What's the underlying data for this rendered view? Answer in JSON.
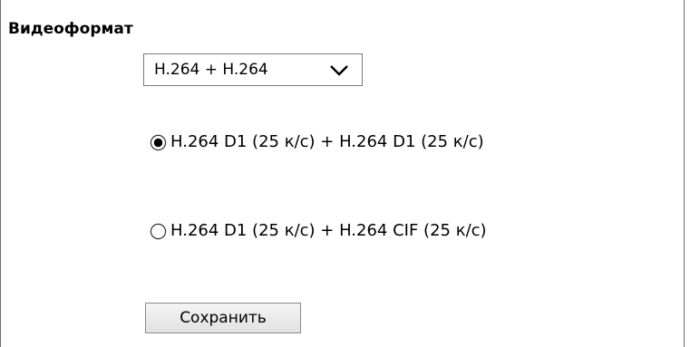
{
  "video_format": {
    "title": "Видеоформат",
    "select": {
      "value": "H.264 + H.264",
      "arrow_icon": "chevron-down-icon"
    },
    "options": [
      {
        "label": "H.264 D1 (25 к/с) + H.264 D1 (25 к/с)",
        "checked": true
      },
      {
        "label": "H.264 D1 (25 к/с) + H.264 CIF (25 к/с)",
        "checked": false
      }
    ],
    "save_label": "Сохранить"
  },
  "colors": {
    "frame_border": "#6b6b6b",
    "text": "#000000",
    "button_bg": "#e2e2e2"
  }
}
